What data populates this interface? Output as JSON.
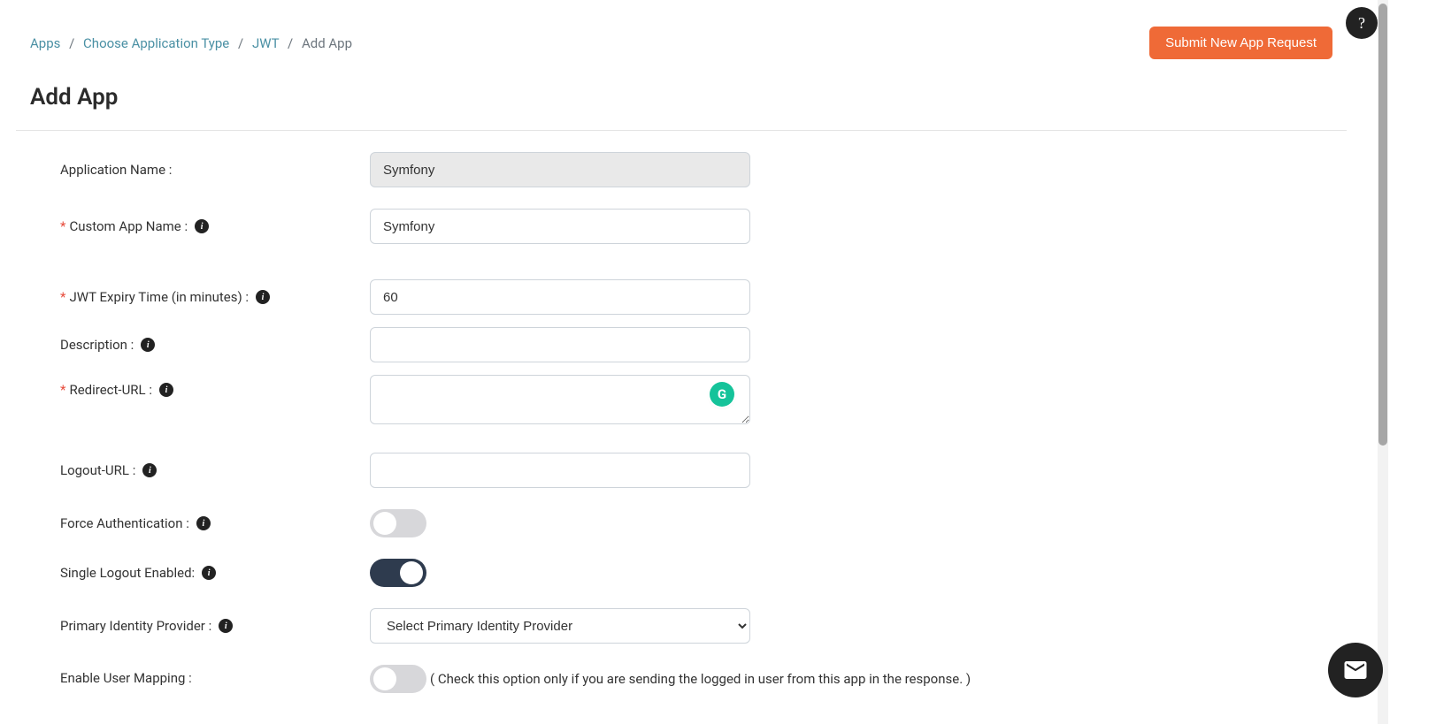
{
  "breadcrumb": {
    "items": [
      {
        "label": "Apps"
      },
      {
        "label": "Choose Application Type"
      },
      {
        "label": "JWT"
      }
    ],
    "current": "Add App"
  },
  "submit_button": "Submit New App Request",
  "page_title": "Add App",
  "form": {
    "app_name": {
      "label": "Application Name :",
      "value": "Symfony"
    },
    "custom_app_name": {
      "label": "Custom App Name :",
      "value": "Symfony",
      "required": true
    },
    "jwt_expiry": {
      "label": "JWT Expiry Time (in minutes) :",
      "value": "60",
      "required": true
    },
    "description": {
      "label": "Description :",
      "value": ""
    },
    "redirect_url": {
      "label": "Redirect-URL :",
      "value": "",
      "required": true
    },
    "logout_url": {
      "label": "Logout-URL :",
      "value": ""
    },
    "force_auth": {
      "label": "Force Authentication :",
      "on": false
    },
    "single_logout": {
      "label": "Single Logout Enabled:",
      "on": true
    },
    "primary_idp": {
      "label": "Primary Identity Provider :",
      "selected": "Select Primary Identity Provider"
    },
    "user_mapping": {
      "label": "Enable User Mapping :",
      "on": false,
      "hint": "( Check this option only if you are sending the logged in user from this app in the response. )"
    }
  },
  "icons": {
    "help": "?",
    "grammarly": "G"
  }
}
